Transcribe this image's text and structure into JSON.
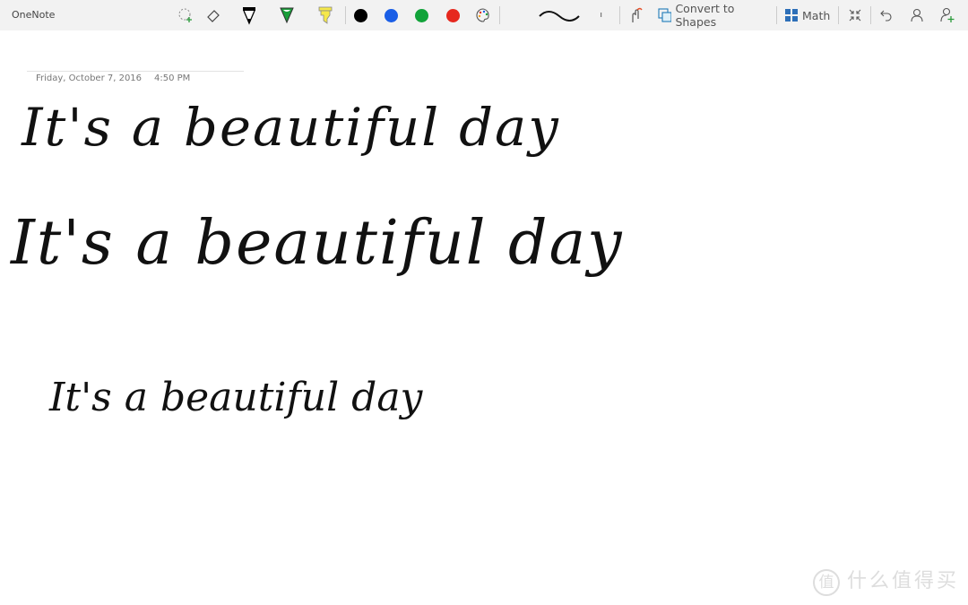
{
  "app": {
    "title": "OneNote"
  },
  "toolbar": {
    "colors": {
      "black": "#000000",
      "blue": "#1a5ee6",
      "green": "#12a33a",
      "red": "#e6281e",
      "highlighter": "#f5e84a",
      "pen_green": "#1a9e3a"
    },
    "convert_to_shapes": "Convert to Shapes",
    "math": "Math"
  },
  "page": {
    "date": "Friday, October 7, 2016",
    "time": "4:50 PM"
  },
  "ink_lines": [
    "It's a beautiful day",
    "It's a beautiful day",
    "It's a beautiful day"
  ],
  "watermark": {
    "logo": "值",
    "text": "什么值得买"
  }
}
